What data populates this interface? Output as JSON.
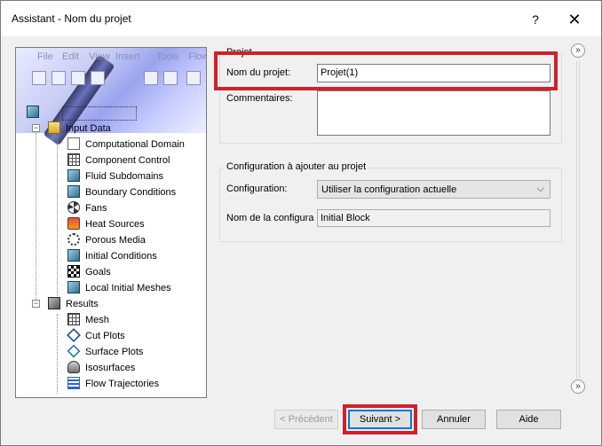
{
  "window": {
    "title": "Assistant - Nom du projet",
    "help_glyph": "?",
    "close_glyph": "✕"
  },
  "preview": {
    "menu": [
      "File",
      "Edit",
      "View",
      "Insert",
      "Tools",
      "Flow"
    ],
    "tree": {
      "input_data": "Input Data",
      "input_items": [
        "Computational Domain",
        "Component Control",
        "Fluid Subdomains",
        "Boundary Conditions",
        "Fans",
        "Heat Sources",
        "Porous Media",
        "Initial Conditions",
        "Goals",
        "Local Initial Meshes"
      ],
      "results": "Results",
      "result_items": [
        "Mesh",
        "Cut Plots",
        "Surface Plots",
        "Isosurfaces",
        "Flow Trajectories"
      ]
    }
  },
  "projet": {
    "group_label": "Projet",
    "name_label": "Nom du projet:",
    "name_value": "Projet(1)",
    "comments_label": "Commentaires:",
    "comments_value": ""
  },
  "configuration": {
    "group_label": "Configuration à ajouter au projet",
    "config_label": "Configuration:",
    "config_value": "Utiliser la configuration actuelle",
    "name_label": "Nom de la configura",
    "name_value": "Initial Block"
  },
  "side": {
    "collapse_glyph": "»"
  },
  "buttons": {
    "prev": "< Précédent",
    "next": "Suivant >",
    "cancel": "Annuler",
    "help": "Aide"
  },
  "colors": {
    "highlight": "#d0202a",
    "focus": "#0078d7"
  }
}
